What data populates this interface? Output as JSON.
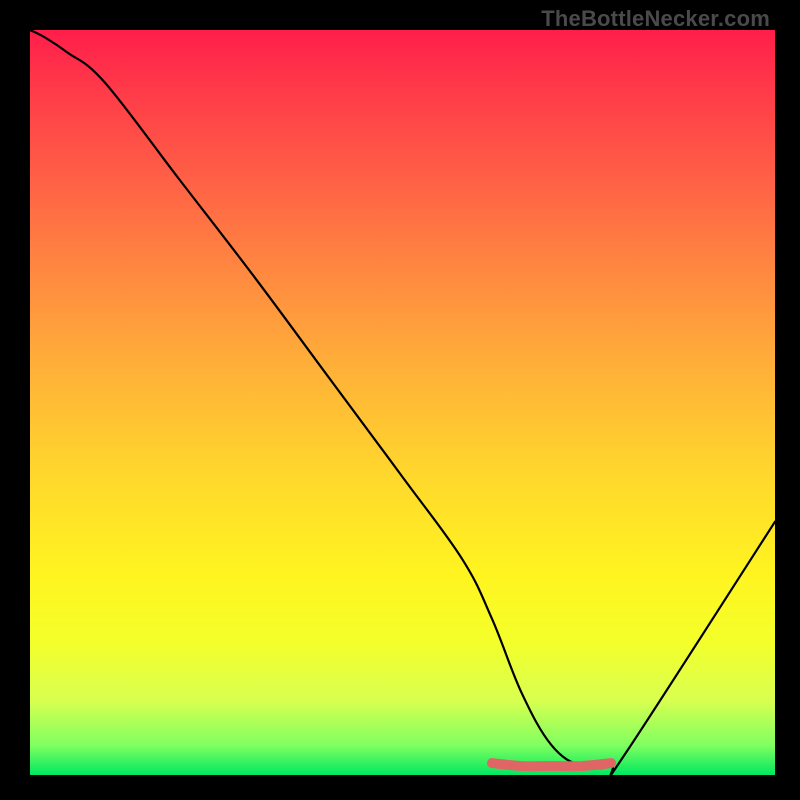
{
  "watermark": "TheBottleNecker.com",
  "chart_data": {
    "type": "line",
    "title": "",
    "xlabel": "",
    "ylabel": "",
    "xlim": [
      0,
      100
    ],
    "ylim": [
      0,
      100
    ],
    "x": [
      0,
      2,
      5,
      10,
      20,
      30,
      40,
      50,
      58,
      62,
      66,
      70,
      74,
      78,
      80,
      100
    ],
    "values": [
      100,
      99,
      97,
      93,
      80,
      67,
      53.5,
      40,
      29,
      21,
      11,
      4,
      1.2,
      1.2,
      3,
      34
    ],
    "highlight": {
      "x": [
        62,
        66,
        70,
        74,
        78
      ],
      "values": [
        1.6,
        1.2,
        1.2,
        1.2,
        1.6
      ]
    },
    "gradient_stops": [
      {
        "pos": 0.0,
        "color": "#ff1e4a"
      },
      {
        "pos": 0.33,
        "color": "#ff8a40"
      },
      {
        "pos": 0.66,
        "color": "#ffe825"
      },
      {
        "pos": 0.92,
        "color": "#d8ff50"
      },
      {
        "pos": 1.0,
        "color": "#00e860"
      }
    ]
  }
}
